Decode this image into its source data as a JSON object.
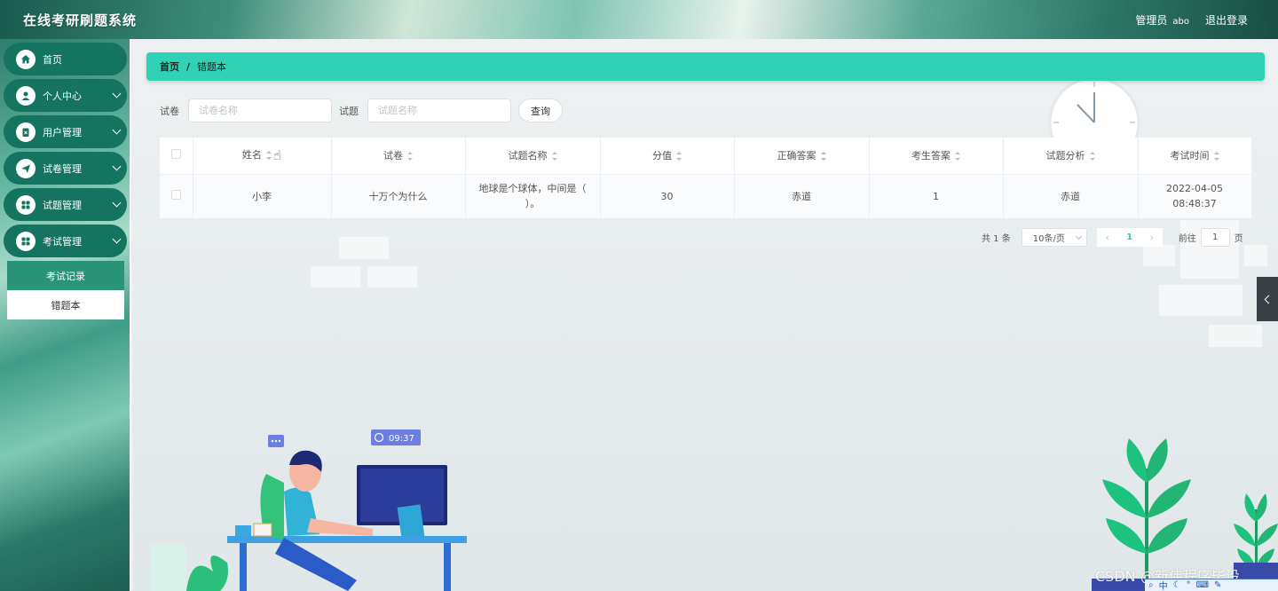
{
  "header": {
    "title": "在线考研刷题系统",
    "role": "管理员",
    "username": "abo",
    "logout": "退出登录"
  },
  "sidebar": {
    "items": [
      {
        "label": "首页",
        "icon": "home-icon"
      },
      {
        "label": "个人中心",
        "icon": "user-icon"
      },
      {
        "label": "用户管理",
        "icon": "clipboard-icon"
      },
      {
        "label": "试卷管理",
        "icon": "send-icon"
      },
      {
        "label": "试题管理",
        "icon": "grid-icon"
      },
      {
        "label": "考试管理",
        "icon": "grid-icon"
      }
    ],
    "submenu": [
      {
        "label": "考试记录"
      },
      {
        "label": "错题本"
      }
    ]
  },
  "breadcrumb": {
    "home": "首页",
    "separator": "/",
    "current": "错题本"
  },
  "search": {
    "paper_label": "试卷",
    "paper_placeholder": "试卷名称",
    "question_label": "试题",
    "question_placeholder": "试题名称",
    "button": "查询"
  },
  "table": {
    "headers": [
      "姓名",
      "试卷",
      "试题名称",
      "分值",
      "正确答案",
      "考生答案",
      "试题分析",
      "考试时间"
    ],
    "rows": [
      [
        "小李",
        "十万个为什么",
        "地球是个球体，中间是（ ）。",
        "30",
        "赤道",
        "1",
        "赤道",
        "2022-04-05 08:48:37"
      ]
    ]
  },
  "pagination": {
    "total": "共 1 条",
    "page_size": "10条/页",
    "current_page": "1",
    "goto_label": "前往",
    "goto_value": "1",
    "page_unit": "页"
  },
  "illustration": {
    "clock_text": "09:37"
  },
  "watermark": "CSDN @新伟程序毕设"
}
